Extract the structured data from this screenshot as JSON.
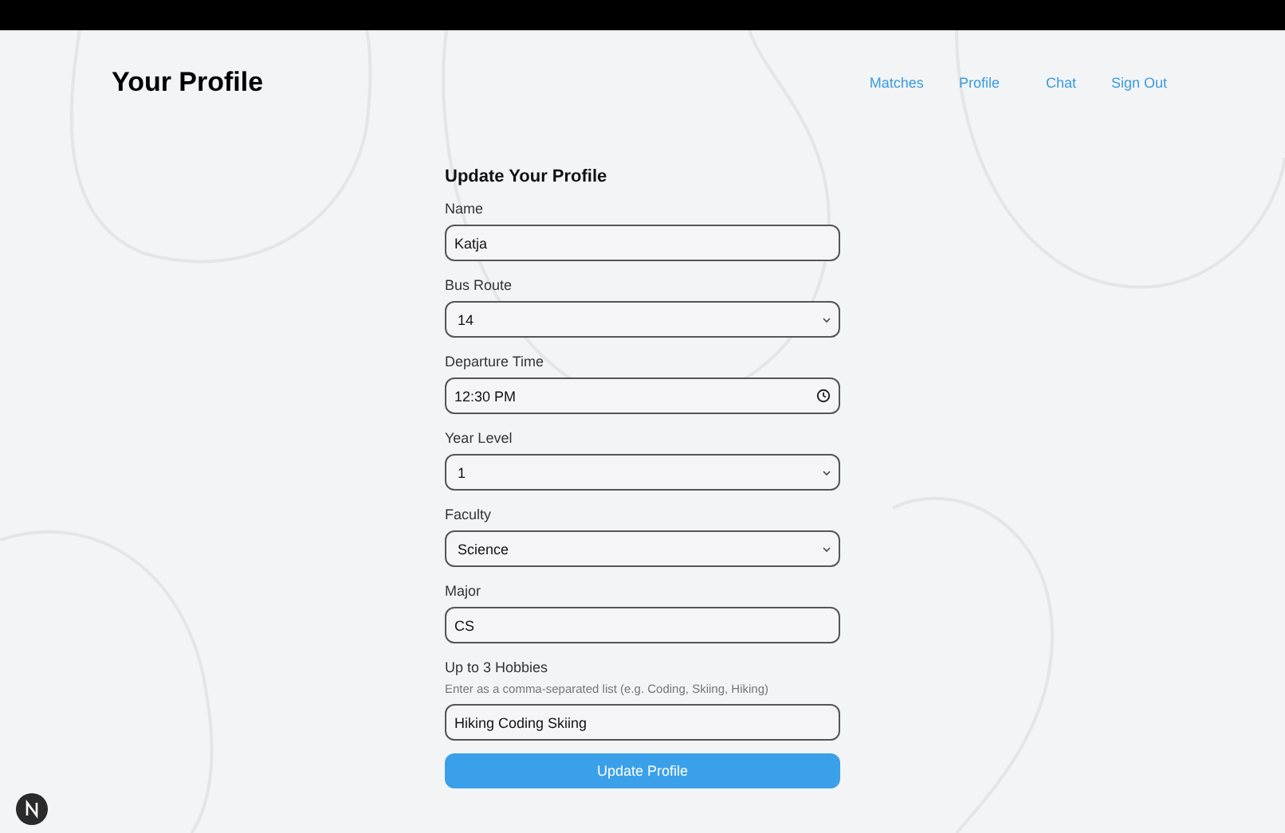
{
  "header": {
    "title": "Your Profile",
    "nav": [
      {
        "label": "Matches"
      },
      {
        "label": "Profile"
      },
      {
        "label": "Chat"
      },
      {
        "label": "Sign Out"
      }
    ]
  },
  "form": {
    "title": "Update Your Profile",
    "fields": [
      {
        "kind": "text",
        "label": "Name",
        "value": "Katja"
      },
      {
        "kind": "select",
        "label": "Bus Route",
        "value": "14"
      },
      {
        "kind": "time",
        "label": "Departure Time",
        "value": "12:30 PM"
      },
      {
        "kind": "select",
        "label": "Year Level",
        "value": "1"
      },
      {
        "kind": "select",
        "label": "Faculty",
        "value": "Science"
      },
      {
        "kind": "text",
        "label": "Major",
        "value": "CS"
      },
      {
        "kind": "text",
        "label": "Up to 3 Hobbies",
        "hint": "Enter as a comma-separated list (e.g. Coding, Skiing, Hiking)",
        "value": "Hiking Coding Skiing"
      }
    ],
    "submit": "Update Profile"
  }
}
